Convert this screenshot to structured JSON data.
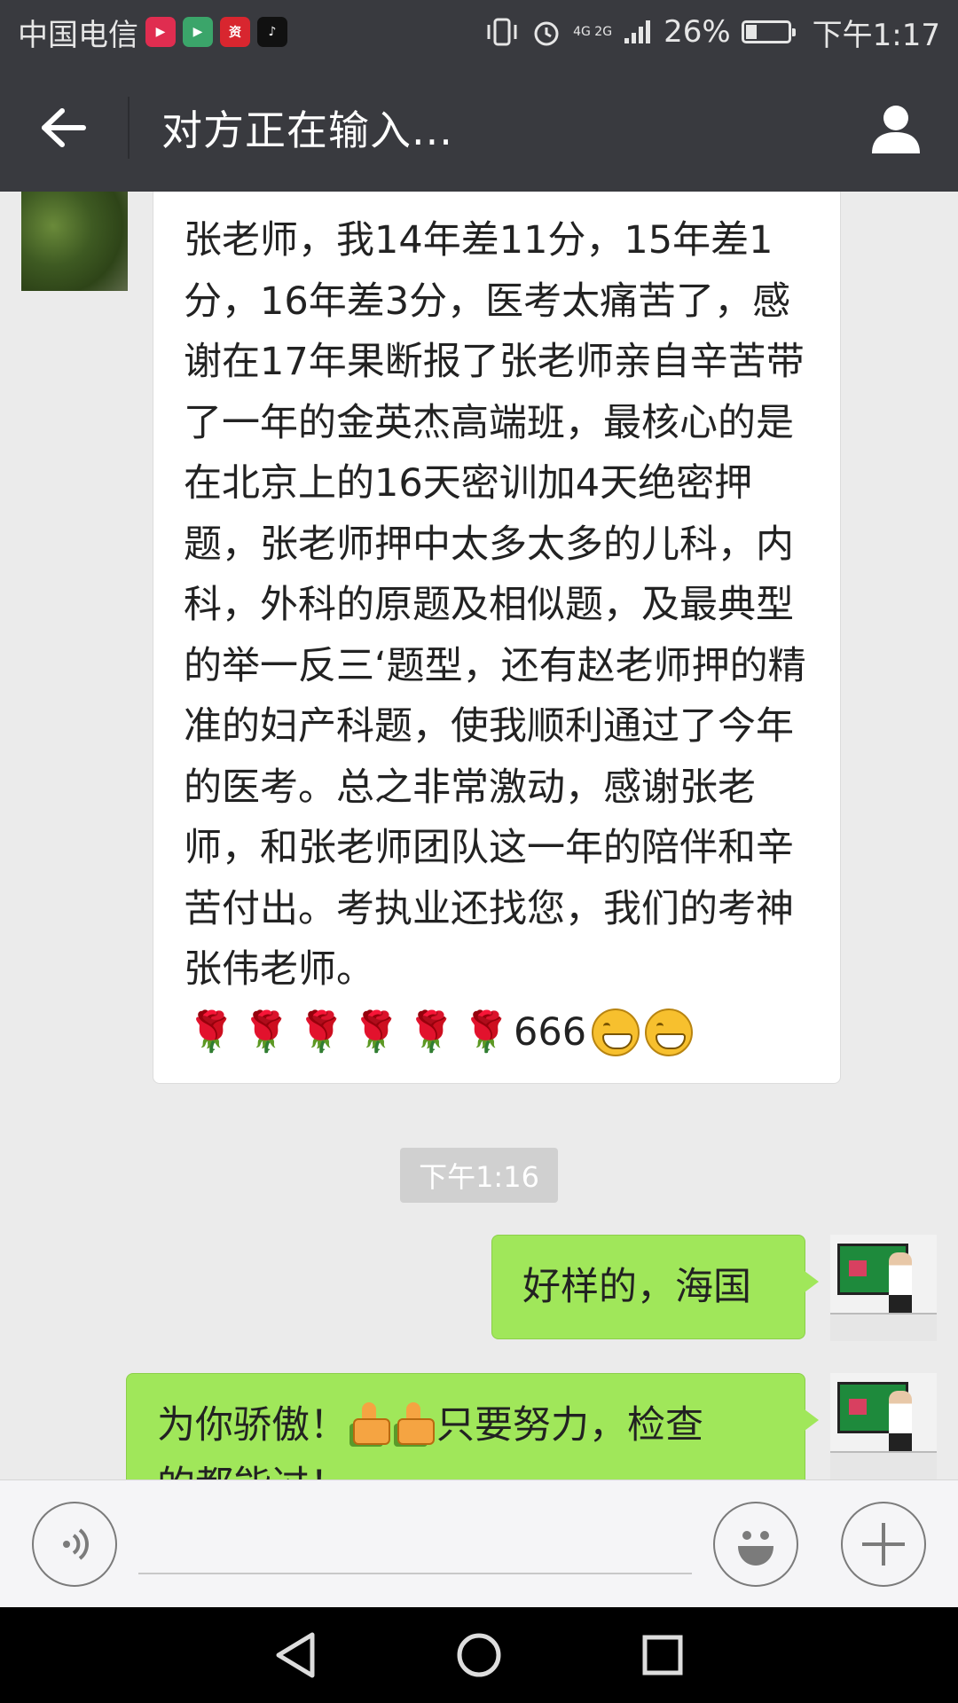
{
  "status_bar": {
    "carrier": "中国电信",
    "network": "4G 2G",
    "battery": "26%",
    "battery_level": 0.26,
    "time": "下午1:17",
    "app_icons": [
      "video-app-icon",
      "play-app-icon",
      "news-app-icon",
      "tiktok-icon"
    ]
  },
  "header": {
    "title": "对方正在输入..."
  },
  "messages": [
    {
      "side": "left",
      "text": "张老师，我14年差11分，15年差1分，16年差3分，医考太痛苦了，感谢在17年果断报了张老师亲自辛苦带了一年的金英杰高端班，最核心的是在北京上的16天密训加4天绝密押题，张老师押中太多太多的儿科，内科，外科的原题及相似题，及最典型的举一反三‘题型，还有赵老师押的精准的妇产科题，使我顺利通过了今年的医考。总之非常激动，感谢张老师，和张老师团队这一年的陪伴和辛苦付出。考执业还找您，我们的考神张伟老师。",
      "tail_text": "666"
    },
    {
      "timestamp": "下午1:16"
    },
    {
      "side": "right",
      "text": "好样的，海国"
    },
    {
      "side": "right",
      "text_before_emoji": "为你骄傲！",
      "text_after_emoji": "只要努力，检查",
      "text_line2": "的都能过！"
    }
  ],
  "colors": {
    "header_bg": "#393a3f",
    "chat_bg": "#ebebeb",
    "bubble_self": "#a0e75a",
    "bubble_other": "#ffffff"
  }
}
